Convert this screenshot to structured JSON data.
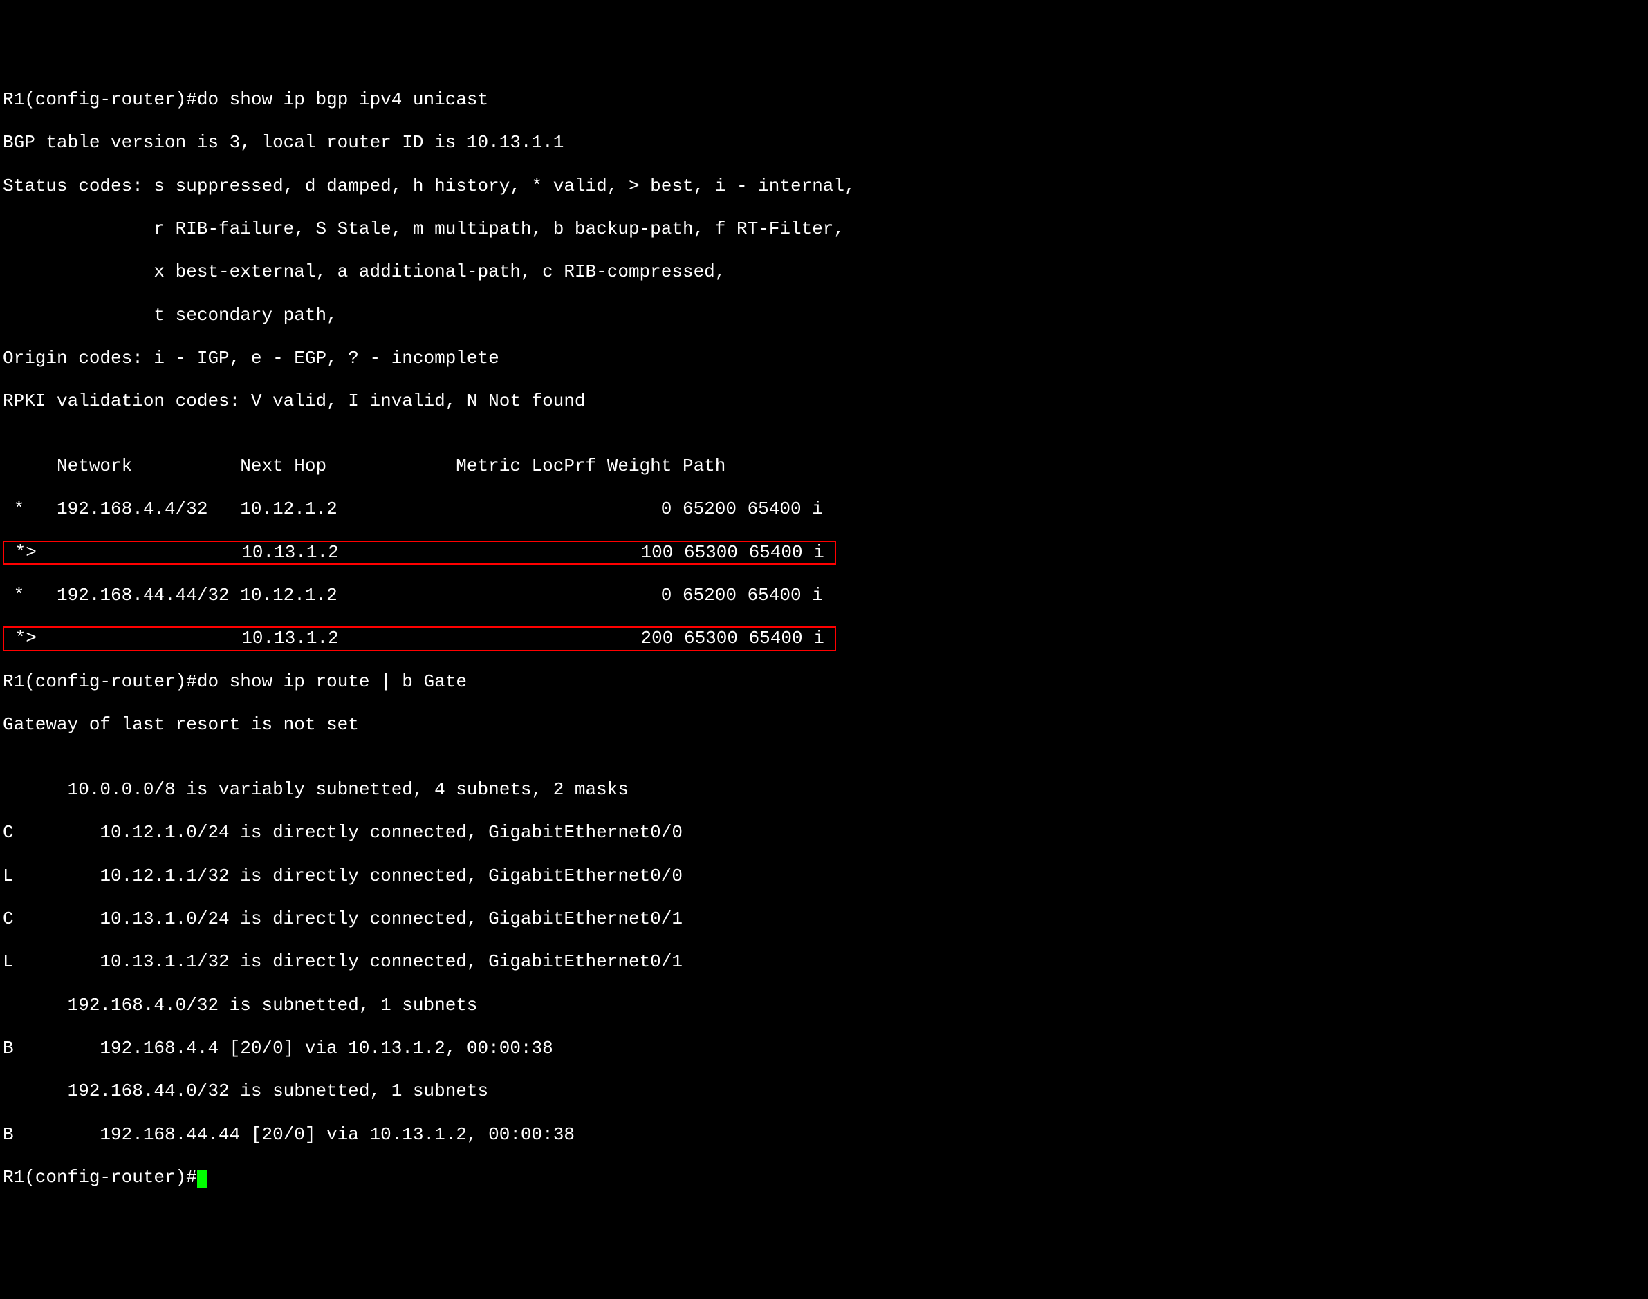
{
  "prompt1": "R1(config-router)#",
  "cmd1": "do show ip bgp ipv4 unicast",
  "line1": "BGP table version is 3, local router ID is 10.13.1.1",
  "line2": "Status codes: s suppressed, d damped, h history, * valid, > best, i - internal,",
  "line3": "              r RIB-failure, S Stale, m multipath, b backup-path, f RT-Filter,",
  "line4": "              x best-external, a additional-path, c RIB-compressed,",
  "line5": "              t secondary path,",
  "line6": "Origin codes: i - IGP, e - EGP, ? - incomplete",
  "line7": "RPKI validation codes: V valid, I invalid, N Not found",
  "blank1": "",
  "header": "     Network          Next Hop            Metric LocPrf Weight Path",
  "row1": " *   192.168.4.4/32   10.12.1.2                              0 65200 65400 i",
  "row2": " *>                   10.13.1.2                            100 65300 65400 i ",
  "row3": " *   192.168.44.44/32 10.12.1.2                              0 65200 65400 i",
  "row4": " *>                   10.13.1.2                            200 65300 65400 i ",
  "prompt2": "R1(config-router)#",
  "cmd2": "do show ip route | b Gate",
  "route1": "Gateway of last resort is not set",
  "blank2": "",
  "route2": "      10.0.0.0/8 is variably subnetted, 4 subnets, 2 masks",
  "route3": "C        10.12.1.0/24 is directly connected, GigabitEthernet0/0",
  "route4": "L        10.12.1.1/32 is directly connected, GigabitEthernet0/0",
  "route5": "C        10.13.1.0/24 is directly connected, GigabitEthernet0/1",
  "route6": "L        10.13.1.1/32 is directly connected, GigabitEthernet0/1",
  "route7": "      192.168.4.0/32 is subnetted, 1 subnets",
  "route8": "B        192.168.4.4 [20/0] via 10.13.1.2, 00:00:38",
  "route9": "      192.168.44.0/32 is subnetted, 1 subnets",
  "route10": "B        192.168.44.44 [20/0] via 10.13.1.2, 00:00:38",
  "prompt3": "R1(config-router)#"
}
